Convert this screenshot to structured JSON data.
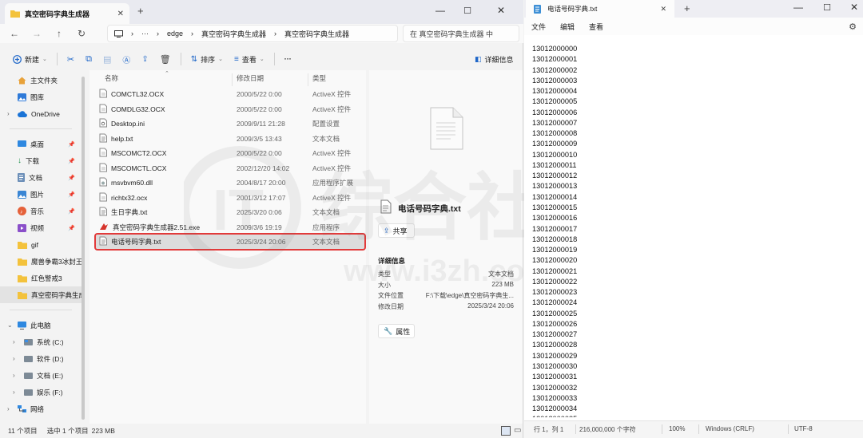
{
  "explorer": {
    "tab_title": "真空密码字典生成器",
    "address": {
      "segments": [
        "edge",
        "真空密码字典生成器",
        "真空密码字典生成器"
      ]
    },
    "search_placeholder": "在 真空密码字典生成器 中",
    "commands": {
      "new": "新建",
      "sort": "排序",
      "view": "查看",
      "more": "···",
      "details": "详细信息"
    },
    "sidebar": {
      "top": [
        {
          "label": "主文件夹",
          "icon": "home-icon"
        },
        {
          "label": "图库",
          "icon": "gallery-icon"
        },
        {
          "label": "OneDrive",
          "icon": "cloud-icon"
        }
      ],
      "quick": [
        {
          "label": "桌面",
          "icon": "desktop-icon"
        },
        {
          "label": "下载",
          "icon": "download-icon"
        },
        {
          "label": "文档",
          "icon": "document-icon"
        },
        {
          "label": "图片",
          "icon": "picture-icon"
        },
        {
          "label": "音乐",
          "icon": "music-icon"
        },
        {
          "label": "视频",
          "icon": "video-icon"
        },
        {
          "label": "gif",
          "icon": "folder-icon"
        },
        {
          "label": "魔兽争霸3冰封王",
          "icon": "folder-icon"
        },
        {
          "label": "红色警戒3",
          "icon": "folder-icon"
        },
        {
          "label": "真空密码字典生成",
          "icon": "folder-icon"
        }
      ],
      "pc": [
        {
          "label": "此电脑",
          "icon": "computer-icon"
        },
        {
          "label": "系统 (C:)",
          "icon": "drive-icon"
        },
        {
          "label": "软件 (D:)",
          "icon": "drive-icon"
        },
        {
          "label": "文档 (E:)",
          "icon": "drive-icon"
        },
        {
          "label": "娱乐 (F:)",
          "icon": "drive-icon"
        },
        {
          "label": "网络",
          "icon": "network-icon"
        }
      ]
    },
    "columns": {
      "name": "名称",
      "date": "修改日期",
      "type": "类型"
    },
    "files": [
      {
        "name": "COMCTL32.OCX",
        "date": "2000/5/22 0:00",
        "type": "ActiveX 控件",
        "icon": "file-icon"
      },
      {
        "name": "COMDLG32.OCX",
        "date": "2000/5/22 0:00",
        "type": "ActiveX 控件",
        "icon": "file-icon"
      },
      {
        "name": "Desktop.ini",
        "date": "2009/9/11 21:28",
        "type": "配置设置",
        "icon": "settings-file-icon"
      },
      {
        "name": "help.txt",
        "date": "2009/3/5 13:43",
        "type": "文本文档",
        "icon": "text-file-icon"
      },
      {
        "name": "MSCOMCT2.OCX",
        "date": "2000/5/22 0:00",
        "type": "ActiveX 控件",
        "icon": "file-icon"
      },
      {
        "name": "MSCOMCTL.OCX",
        "date": "2002/12/20 14:02",
        "type": "ActiveX 控件",
        "icon": "file-icon"
      },
      {
        "name": "msvbvm60.dll",
        "date": "2004/8/17 20:00",
        "type": "应用程序扩展",
        "icon": "dll-file-icon"
      },
      {
        "name": "richtx32.ocx",
        "date": "2001/3/12 17:07",
        "type": "ActiveX 控件",
        "icon": "file-icon"
      },
      {
        "name": "生日字典.txt",
        "date": "2025/3/20 0:06",
        "type": "文本文档",
        "icon": "text-file-icon"
      },
      {
        "name": "真空密码字典生成器2.51.exe",
        "date": "2009/3/6 19:19",
        "type": "应用程序",
        "icon": "exe-icon"
      },
      {
        "name": "电话号码字典.txt",
        "date": "2025/3/24 20:06",
        "type": "文本文档",
        "icon": "text-file-icon"
      }
    ],
    "detail": {
      "filename": "电话号码字典.txt",
      "share": "共享",
      "section": "详细信息",
      "props": [
        {
          "k": "类型",
          "v": "文本文档"
        },
        {
          "k": "大小",
          "v": "223 MB"
        },
        {
          "k": "文件位置",
          "v": "F:\\下载\\edge\\真空密码字典生..."
        },
        {
          "k": "修改日期",
          "v": "2025/3/24 20:06"
        }
      ],
      "properties_btn": "属性"
    },
    "status": {
      "count": "11 个项目",
      "selected": "选中 1 个项目",
      "size": "223 MB"
    }
  },
  "notepad": {
    "tab_title": "电话号码字典.txt",
    "menu": [
      "文件",
      "编辑",
      "查看"
    ],
    "lines": [
      "13012000000",
      "13012000001",
      "13012000002",
      "13012000003",
      "13012000004",
      "13012000005",
      "13012000006",
      "13012000007",
      "13012000008",
      "13012000009",
      "13012000010",
      "13012000011",
      "13012000012",
      "13012000013",
      "13012000014",
      "13012000015",
      "13012000016",
      "13012000017",
      "13012000018",
      "13012000019",
      "13012000020",
      "13012000021",
      "13012000022",
      "13012000023",
      "13012000024",
      "13012000025",
      "13012000026",
      "13012000027",
      "13012000028",
      "13012000029",
      "13012000030",
      "13012000031",
      "13012000032",
      "13012000033",
      "13012000034",
      "13012000035"
    ],
    "status": {
      "position": "行 1，列 1",
      "chars": "216,000,000 个字符",
      "zoom": "100%",
      "eol": "Windows (CRLF)",
      "encoding": "UTF-8"
    }
  },
  "watermark": {
    "text": "IT综合社区",
    "url": "www.i3zh.com"
  }
}
